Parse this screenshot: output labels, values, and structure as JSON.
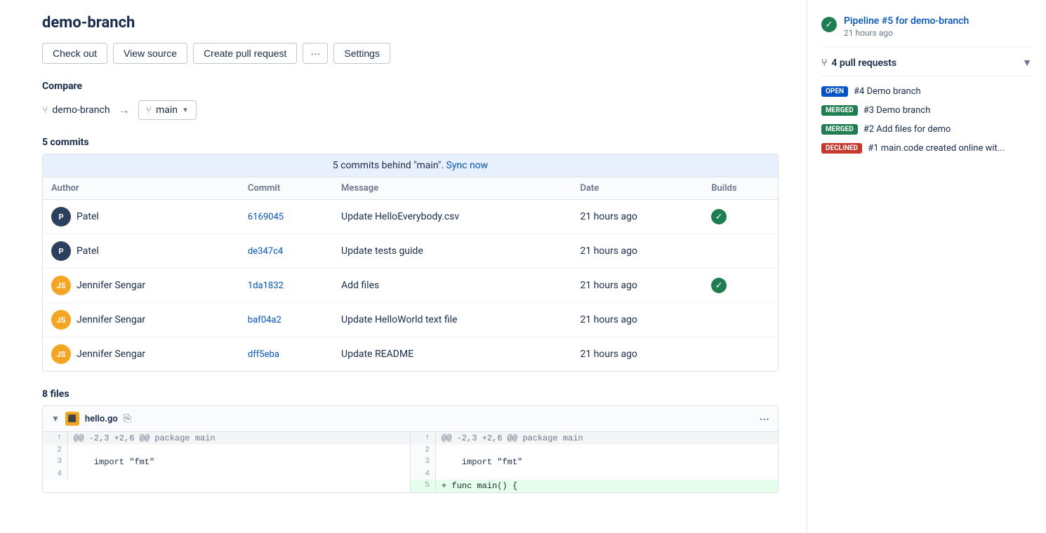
{
  "page": {
    "title": "demo-branch"
  },
  "buttons": {
    "checkout": "Check out",
    "view_source": "View source",
    "create_pull_request": "Create pull request",
    "dots": "···",
    "settings": "Settings"
  },
  "compare": {
    "label": "Compare",
    "from_branch": "demo-branch",
    "to_branch": "main"
  },
  "commits": {
    "label": "5 commits",
    "behind_text": "5 commits behind \"main\".",
    "sync_now": "Sync now",
    "columns": {
      "author": "Author",
      "commit": "Commit",
      "message": "Message",
      "date": "Date",
      "builds": "Builds"
    },
    "rows": [
      {
        "author": "Patel",
        "avatar_initials": "P",
        "avatar_style": "dark",
        "commit": "6169045",
        "message": "Update HelloEverybody.csv",
        "date": "21 hours ago",
        "has_build": true
      },
      {
        "author": "Patel",
        "avatar_initials": "P",
        "avatar_style": "dark",
        "commit": "de347c4",
        "message": "Update tests guide",
        "date": "21 hours ago",
        "has_build": false
      },
      {
        "author": "Jennifer Sengar",
        "avatar_initials": "JS",
        "avatar_style": "orange",
        "commit": "1da1832",
        "message": "Add files",
        "date": "21 hours ago",
        "has_build": true
      },
      {
        "author": "Jennifer Sengar",
        "avatar_initials": "JS",
        "avatar_style": "orange",
        "commit": "baf04a2",
        "message": "Update HelloWorld text file",
        "date": "21 hours ago",
        "has_build": false
      },
      {
        "author": "Jennifer Sengar",
        "avatar_initials": "JS",
        "avatar_style": "orange",
        "commit": "dff5eba",
        "message": "Update README",
        "date": "21 hours ago",
        "has_build": false
      }
    ]
  },
  "files": {
    "label": "8 files",
    "file": {
      "name": "hello.go",
      "diff_header": "@@ -2,3 +2,6 @@ package main",
      "old_lines": [
        {
          "num": "2",
          "content": ""
        },
        {
          "num": "3",
          "content": "    import \"fmt\""
        },
        {
          "num": "4",
          "content": ""
        }
      ],
      "new_lines": [
        {
          "num": "2",
          "content": ""
        },
        {
          "num": "3",
          "content": "    import \"fmt\""
        },
        {
          "num": "4",
          "content": ""
        },
        {
          "num": "5",
          "content": "+ func main() {",
          "added": true
        }
      ]
    }
  },
  "sidebar": {
    "pipeline": {
      "link_text": "Pipeline #5 for demo-branch",
      "time": "21 hours ago"
    },
    "pull_requests": {
      "label": "4 pull requests",
      "items": [
        {
          "badge": "OPEN",
          "badge_style": "open",
          "text": "#4 Demo branch"
        },
        {
          "badge": "MERGED",
          "badge_style": "merged",
          "text": "#3 Demo branch"
        },
        {
          "badge": "MERGED",
          "badge_style": "merged",
          "text": "#2 Add files for demo"
        },
        {
          "badge": "DECLINED",
          "badge_style": "declined",
          "text": "#1 main.code created online wit..."
        }
      ]
    }
  }
}
